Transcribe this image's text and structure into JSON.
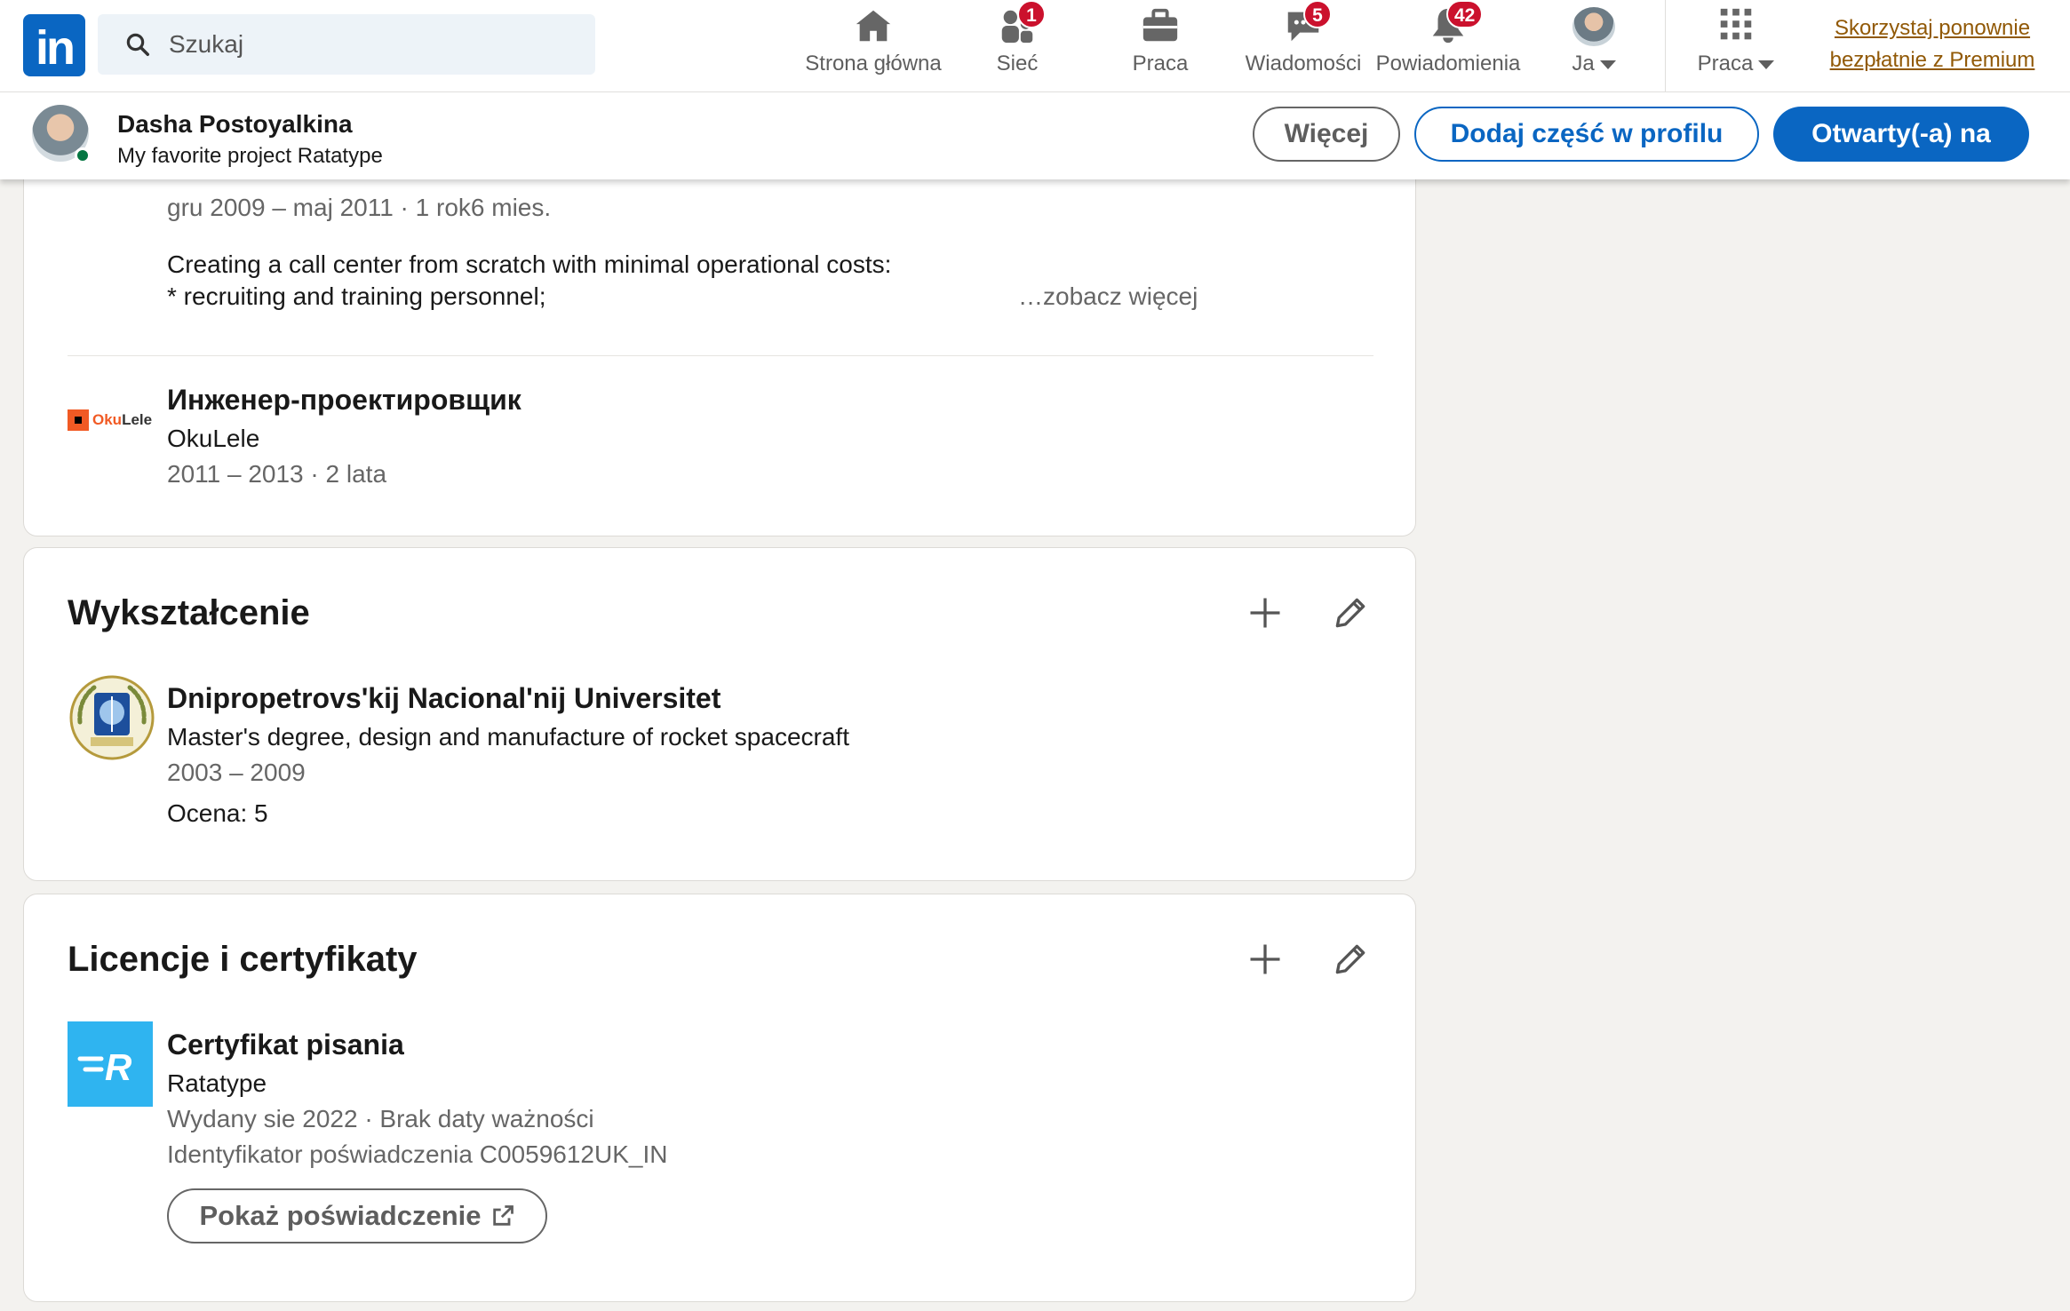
{
  "nav": {
    "logo_text": "in",
    "search_placeholder": "Szukaj",
    "items": [
      {
        "label": "Strona główna",
        "icon": "home-icon"
      },
      {
        "label": "Sieć",
        "icon": "network-icon",
        "badge": "1"
      },
      {
        "label": "Praca",
        "icon": "briefcase-icon"
      },
      {
        "label": "Wiadomości",
        "icon": "messaging-icon",
        "badge": "5"
      },
      {
        "label": "Powiadomienia",
        "icon": "bell-icon",
        "badge": "42"
      },
      {
        "label": "Ja",
        "icon": "avatar"
      },
      {
        "label": "Praca",
        "icon": "grid-icon"
      }
    ],
    "premium_line1": "Skorzystaj ponownie",
    "premium_line2": "bezpłatnie z Premium"
  },
  "profile_bar": {
    "name": "Dasha Postoyalkina",
    "headline": "My favorite project Ratatype",
    "more_label": "Więcej",
    "add_section_label": "Dodaj część w profilu",
    "open_to_label": "Otwarty(-a) na"
  },
  "experience": {
    "prev_dates": "gru 2009 – maj 2011 · 1 rok6 mies.",
    "prev_desc_line1": "Creating a call center from scratch with minimal operational costs:",
    "prev_desc_line2": "* recruiting and training personnel;",
    "see_more": "…zobacz więcej",
    "job_title": "Инженер-проектировщик",
    "company": "OkuLele",
    "company_logo_a": "Oku",
    "company_logo_b": "Lele",
    "dates": "2011 – 2013 · 2 lata"
  },
  "education": {
    "heading": "Wykształcenie",
    "school": "Dnipropetrovs'kij Nacional'nij Universitet",
    "degree": "Master's degree, design and manufacture of rocket spacecraft",
    "dates": "2003 – 2009",
    "grade": "Ocena: 5"
  },
  "certs": {
    "heading": "Licencje i certyfikaty",
    "name": "Certyfikat pisania",
    "issuer": "Ratatype",
    "issued": "Wydany sie 2022 · Brak daty ważności",
    "credential_id": "Identyfikator poświadczenia C0059612UK_IN",
    "show_credential": "Pokaż poświadczenie"
  },
  "colors": {
    "brand_blue": "#0a66c2",
    "badge_red": "#cb112d",
    "premium_gold": "#915907",
    "background": "#f3f2ef"
  }
}
